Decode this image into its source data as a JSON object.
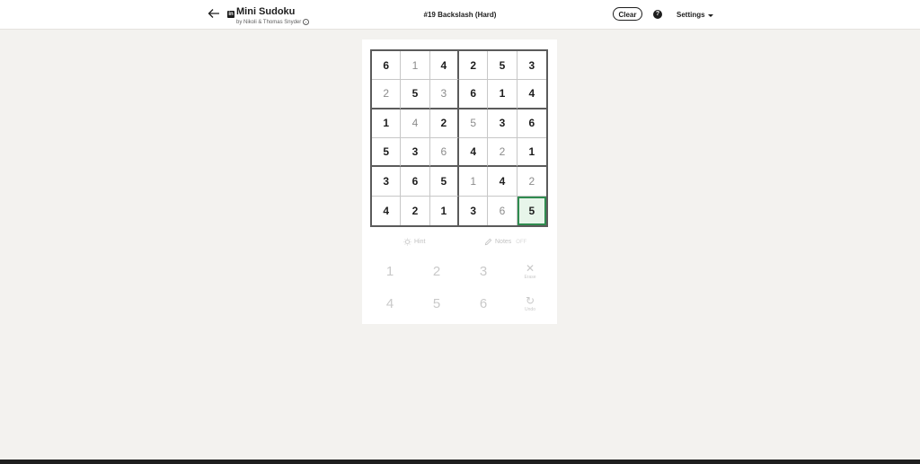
{
  "header": {
    "app_title": "Mini Sudoku",
    "byline": "by Nikoli & Thomas Snyder",
    "puzzle_title": "#19 Backslash (Hard)",
    "clear_label": "Clear",
    "settings_label": "Settings",
    "icons": {
      "back": "back-arrow-icon",
      "logo": "linkedin-icon",
      "info": "info-icon",
      "help": "help-icon",
      "settings": "chevron-down-icon"
    }
  },
  "board": {
    "rows": [
      [
        {
          "v": "6",
          "t": "given"
        },
        {
          "v": "1",
          "t": "entered"
        },
        {
          "v": "4",
          "t": "given"
        },
        {
          "v": "2",
          "t": "given"
        },
        {
          "v": "5",
          "t": "given"
        },
        {
          "v": "3",
          "t": "given"
        }
      ],
      [
        {
          "v": "2",
          "t": "entered"
        },
        {
          "v": "5",
          "t": "given"
        },
        {
          "v": "3",
          "t": "entered"
        },
        {
          "v": "6",
          "t": "given"
        },
        {
          "v": "1",
          "t": "given"
        },
        {
          "v": "4",
          "t": "given"
        }
      ],
      [
        {
          "v": "1",
          "t": "given"
        },
        {
          "v": "4",
          "t": "entered"
        },
        {
          "v": "2",
          "t": "given"
        },
        {
          "v": "5",
          "t": "entered"
        },
        {
          "v": "3",
          "t": "given"
        },
        {
          "v": "6",
          "t": "given"
        }
      ],
      [
        {
          "v": "5",
          "t": "given"
        },
        {
          "v": "3",
          "t": "given"
        },
        {
          "v": "6",
          "t": "entered"
        },
        {
          "v": "4",
          "t": "given"
        },
        {
          "v": "2",
          "t": "entered"
        },
        {
          "v": "1",
          "t": "given"
        }
      ],
      [
        {
          "v": "3",
          "t": "given"
        },
        {
          "v": "6",
          "t": "given"
        },
        {
          "v": "5",
          "t": "given"
        },
        {
          "v": "1",
          "t": "entered"
        },
        {
          "v": "4",
          "t": "given"
        },
        {
          "v": "2",
          "t": "entered"
        }
      ],
      [
        {
          "v": "4",
          "t": "given"
        },
        {
          "v": "2",
          "t": "given"
        },
        {
          "v": "1",
          "t": "given"
        },
        {
          "v": "3",
          "t": "given"
        },
        {
          "v": "6",
          "t": "entered"
        },
        {
          "v": "5",
          "t": "given"
        }
      ]
    ],
    "selected": [
      5,
      5
    ],
    "colors": {
      "selected_border": "#2f8b4f",
      "selected_fill": "#e7f5ea",
      "given": "#1d1d1d",
      "entered": "#8c8c8c"
    }
  },
  "tools": {
    "hint_label": "Hint",
    "notes_label": "Notes",
    "notes_state": "OFF"
  },
  "keypad": {
    "numbers": [
      "1",
      "2",
      "3",
      "4",
      "5",
      "6"
    ],
    "erase_label": "Erase",
    "undo_label": "Undo"
  }
}
